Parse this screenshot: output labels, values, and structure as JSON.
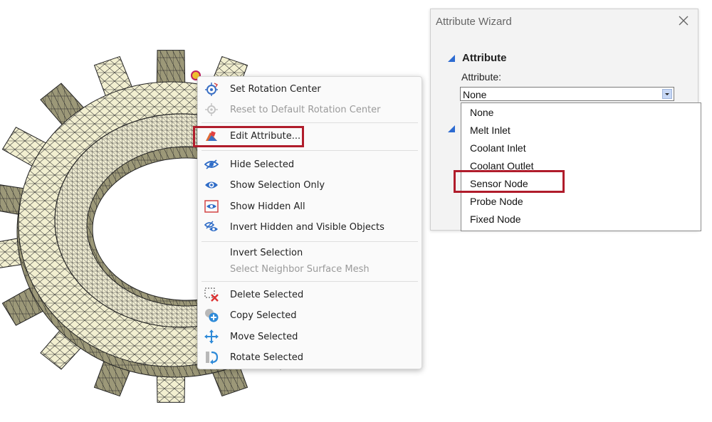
{
  "context_menu": {
    "items": [
      {
        "label": "Set Rotation Center",
        "icon": "rotation-center-icon",
        "enabled": true
      },
      {
        "label": "Reset to Default Rotation Center",
        "icon": "reset-rotation-center-icon",
        "enabled": false
      },
      {
        "label": "Edit Attribute...",
        "icon": "edit-attribute-icon",
        "enabled": true
      },
      {
        "label": "Hide Selected",
        "icon": "hide-eye-icon",
        "enabled": true
      },
      {
        "label": "Show Selection Only",
        "icon": "show-eye-icon",
        "enabled": true
      },
      {
        "label": "Show Hidden All",
        "icon": "show-hidden-icon",
        "enabled": true
      },
      {
        "label": "Invert Hidden and Visible Objects",
        "icon": "invert-visibility-icon",
        "enabled": true
      },
      {
        "label": "Invert Selection",
        "icon": "",
        "enabled": true
      },
      {
        "label": "Select Neighbor Surface Mesh",
        "icon": "",
        "enabled": false
      },
      {
        "label": "Delete Selected",
        "icon": "delete-selection-icon",
        "enabled": true
      },
      {
        "label": "Copy Selected",
        "icon": "copy-plus-icon",
        "enabled": true
      },
      {
        "label": "Move Selected",
        "icon": "move-arrows-icon",
        "enabled": true
      },
      {
        "label": "Rotate Selected",
        "icon": "rotate-arrow-icon",
        "enabled": true
      }
    ]
  },
  "wizard": {
    "title": "Attribute Wizard",
    "section_title": "Attribute",
    "attribute_label": "Attribute:",
    "selected_value": "None",
    "options": [
      "None",
      "Melt Inlet",
      "Coolant Inlet",
      "Coolant Outlet",
      "Sensor Node",
      "Probe Node",
      "Fixed Node"
    ],
    "highlighted_option": "Sensor Node"
  },
  "colors": {
    "mesh_face": "#f2efd0",
    "mesh_line": "#2b2b2b",
    "highlight_box": "#b01c2b",
    "accent_blue": "#2d6bd1"
  }
}
